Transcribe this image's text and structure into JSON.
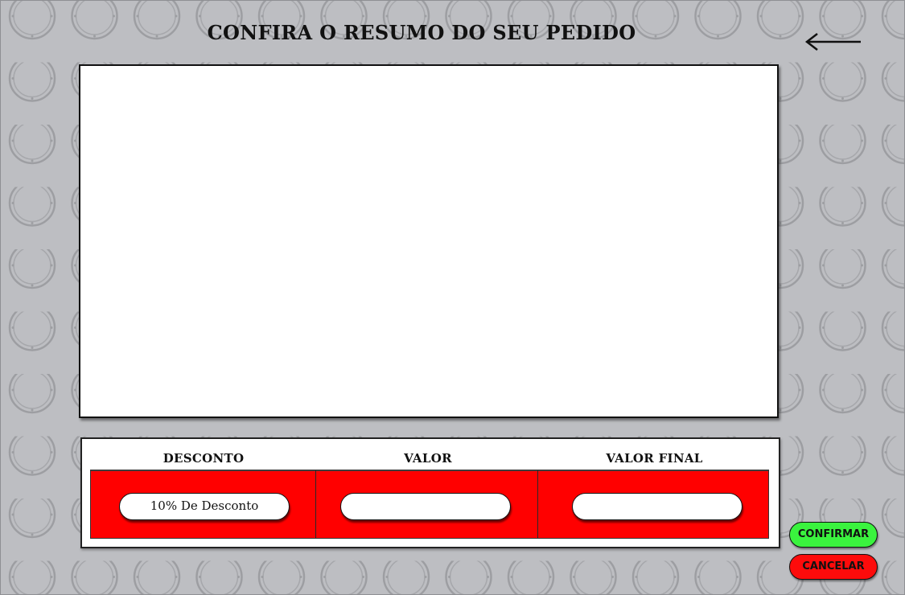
{
  "header": {
    "title": "CONFIRA O RESUMO DO SEU PEDIDO",
    "back_icon": "arrow-left-icon"
  },
  "summary": {
    "content": ""
  },
  "totals": {
    "discount_label": "DESCONTO",
    "value_label": "VALOR",
    "final_value_label": "VALOR FINAL",
    "discount_value": "10% De Desconto",
    "value": "",
    "final_value": ""
  },
  "actions": {
    "confirm_label": "CONFIRMAR",
    "cancel_label": "CANCELAR"
  },
  "colors": {
    "background": "#bdbec2",
    "totals_bar": "#ff0000",
    "confirm": "#3af33e",
    "cancel": "#fd0b0b"
  },
  "decoration": {
    "background_icon": "porthole-ring-icon"
  }
}
